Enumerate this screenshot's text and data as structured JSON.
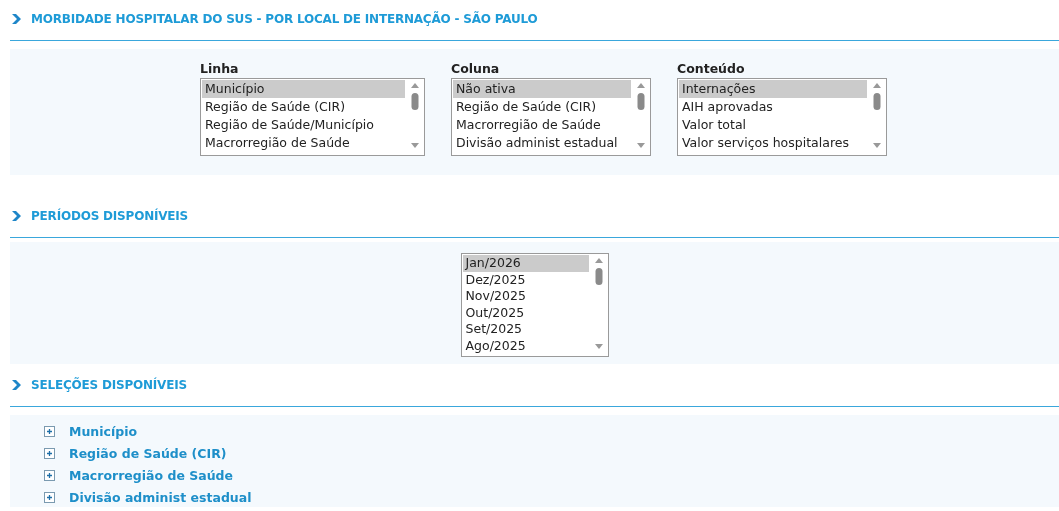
{
  "sections": [
    {
      "title": "MORBIDADE HOSPITALAR DO SUS - POR LOCAL DE INTERNAÇÃO - SÃO PAULO",
      "kind": "selects",
      "lists": [
        {
          "label": "Linha",
          "options": [
            {
              "text": "Município",
              "selected": true
            },
            {
              "text": "Região de Saúde (CIR)",
              "selected": false
            },
            {
              "text": "Região de Saúde/Município",
              "selected": false
            },
            {
              "text": "Macrorregião de Saúde",
              "selected": false
            }
          ]
        },
        {
          "label": "Coluna",
          "options": [
            {
              "text": "Não ativa",
              "selected": true
            },
            {
              "text": "Região de Saúde (CIR)",
              "selected": false
            },
            {
              "text": "Macrorregião de Saúde",
              "selected": false
            },
            {
              "text": "Divisão administ estadual",
              "selected": false
            }
          ]
        },
        {
          "label": "Conteúdo",
          "options": [
            {
              "text": "Internações",
              "selected": true
            },
            {
              "text": "AIH aprovadas",
              "selected": false
            },
            {
              "text": "Valor total",
              "selected": false
            },
            {
              "text": "Valor serviços hospitalares",
              "selected": false
            }
          ]
        }
      ]
    },
    {
      "title": "PERÍODOS DISPONÍVEIS",
      "kind": "periods",
      "options": [
        {
          "text": "Jan/2026",
          "selected": true
        },
        {
          "text": "Dez/2025",
          "selected": false
        },
        {
          "text": "Nov/2025",
          "selected": false
        },
        {
          "text": "Out/2025",
          "selected": false
        },
        {
          "text": "Set/2025",
          "selected": false
        },
        {
          "text": "Ago/2025",
          "selected": false
        }
      ]
    },
    {
      "title": "SELEÇÕES DISPONÍVEIS",
      "kind": "tree",
      "items": [
        {
          "text": "Município",
          "expanded": false
        },
        {
          "text": "Região de Saúde (CIR)",
          "expanded": false
        },
        {
          "text": "Macrorregião de Saúde",
          "expanded": false
        },
        {
          "text": "Divisão administ estadual",
          "expanded": false
        }
      ]
    }
  ]
}
